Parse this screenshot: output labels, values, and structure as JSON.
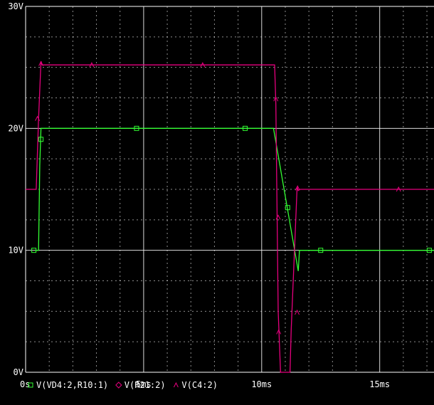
{
  "chart_data": {
    "type": "line",
    "title": "",
    "xlabel": "",
    "ylabel": "",
    "xlim": [
      0,
      17.3
    ],
    "ylim": [
      0,
      30
    ],
    "grid": true,
    "x_ticks": [
      {
        "value": 0,
        "label": "0s"
      },
      {
        "value": 5,
        "label": "5ms"
      },
      {
        "value": 10,
        "label": "10ms"
      },
      {
        "value": 15,
        "label": "15ms"
      }
    ],
    "y_ticks": [
      {
        "value": 0,
        "label": "0V"
      },
      {
        "value": 10,
        "label": "10V"
      },
      {
        "value": 20,
        "label": "20V"
      },
      {
        "value": 30,
        "label": "30V"
      }
    ],
    "colors": {
      "background": "#000000",
      "axis": "#ffffff",
      "grid": "#ffffff",
      "series_green": "#33ff33",
      "series_magenta": "#e6007e"
    },
    "series": [
      {
        "name": "V(VD4:2,R10:1)",
        "color": "#33ff33",
        "marker": "square",
        "x": [
          0.4,
          0.55,
          0.6,
          0.65,
          10.5,
          11.55,
          11.6,
          17.3
        ],
        "y": [
          10,
          10,
          17,
          20,
          20,
          8.3,
          10,
          10
        ],
        "marker_x": [
          0.35,
          0.65,
          4.7,
          9.3,
          11.1,
          12.5,
          17.1
        ],
        "marker_y": [
          10,
          19.1,
          20,
          20,
          13.5,
          10,
          10
        ]
      },
      {
        "name": "V(R21:2)",
        "color": "#e6007e",
        "marker": "diamond",
        "x": [],
        "y": [],
        "marker_x": [],
        "marker_y": []
      },
      {
        "name": "V(C4:2)",
        "color": "#e6007e",
        "marker": "triangle",
        "x": [
          0,
          0.45,
          0.55,
          0.65,
          0.7,
          10.55,
          10.6,
          10.7,
          10.8,
          11.2,
          11.25,
          11.5,
          11.55,
          11.6,
          17.3
        ],
        "y": [
          15,
          15,
          20.8,
          25.5,
          25.2,
          25.2,
          22,
          5,
          0,
          0,
          3.5,
          15.2,
          14.9,
          15,
          15
        ],
        "marker_x": [
          0.5,
          0.65,
          2.8,
          7.5,
          10.6,
          10.7,
          10.72,
          11.5,
          11.52,
          15.8
        ],
        "marker_y": [
          20.8,
          25.3,
          25.2,
          25.2,
          22.4,
          12.7,
          3.3,
          4.9,
          15.1,
          15
        ]
      }
    ],
    "legend": {
      "position": "bottom-left",
      "entries": [
        "V(VD4:2,R10:1)",
        "V(R21:2)",
        "V(C4:2)"
      ]
    }
  }
}
